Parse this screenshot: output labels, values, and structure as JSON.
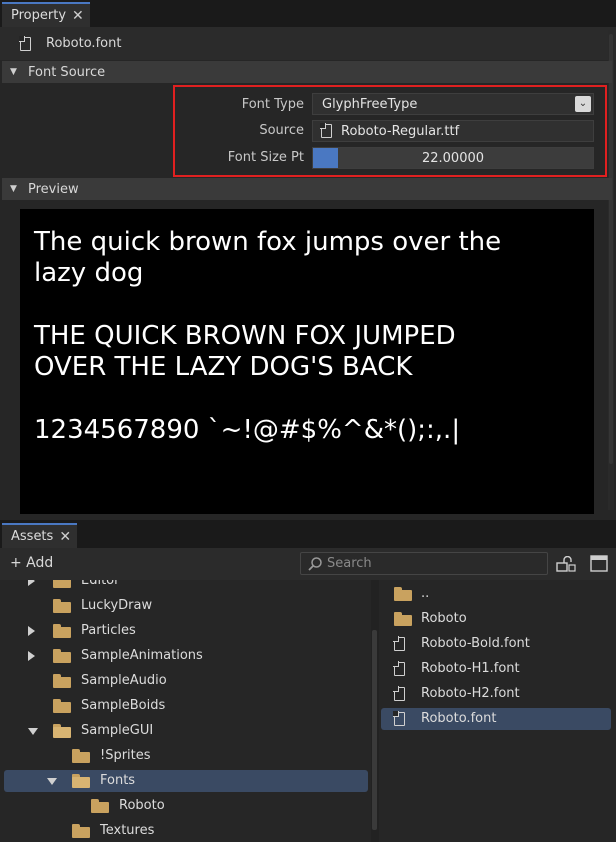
{
  "property_panel": {
    "tab_label": "Property",
    "close_glyph": "✕",
    "asset_name": "Roboto.font",
    "font_source": {
      "header": "Font Source",
      "font_type_label": "Font Type",
      "font_type_value": "GlyphFreeType",
      "source_label": "Source",
      "source_value": "Roboto-Regular.ttf",
      "font_size_label": "Font Size Pt",
      "font_size_value": "22.00000",
      "font_size_fill": 0.09
    },
    "preview": {
      "header": "Preview",
      "line1": "The quick brown fox jumps over the",
      "line2": "lazy dog",
      "line3": "THE QUICK BROWN FOX JUMPED",
      "line4": "OVER THE LAZY DOG'S BACK",
      "line5": "1234567890 `~!@#$%^&*();:,.|"
    }
  },
  "assets_panel": {
    "tab_label": "Assets",
    "close_glyph": "✕",
    "add_label": "+ Add",
    "search_placeholder": "Search",
    "tree": [
      {
        "label": "Editor",
        "arrow": "right"
      },
      {
        "label": "LuckyDraw",
        "arrow": "none"
      },
      {
        "label": "Particles",
        "arrow": "right"
      },
      {
        "label": "SampleAnimations",
        "arrow": "right"
      },
      {
        "label": "SampleAudio",
        "arrow": "none"
      },
      {
        "label": "SampleBoids",
        "arrow": "none"
      },
      {
        "label": "SampleGUI",
        "arrow": "down"
      },
      {
        "label": "!Sprites",
        "arrow": "none"
      },
      {
        "label": "Fonts",
        "arrow": "down",
        "selected": true
      },
      {
        "label": "Roboto",
        "arrow": "none"
      },
      {
        "label": "Textures",
        "arrow": "none"
      }
    ],
    "files": [
      {
        "label": "..",
        "kind": "folder"
      },
      {
        "label": "Roboto",
        "kind": "folder"
      },
      {
        "label": "Roboto-Bold.font",
        "kind": "file"
      },
      {
        "label": "Roboto-H1.font",
        "kind": "file"
      },
      {
        "label": "Roboto-H2.font",
        "kind": "file"
      },
      {
        "label": "Roboto.font",
        "kind": "file",
        "selected": true
      }
    ]
  },
  "colors": {
    "tab_accent": "#4a78c2",
    "highlight_border": "#e02020",
    "selection": "#3a4a63",
    "slider_fill": "#4a78c2",
    "folder": "#c9a25f"
  }
}
